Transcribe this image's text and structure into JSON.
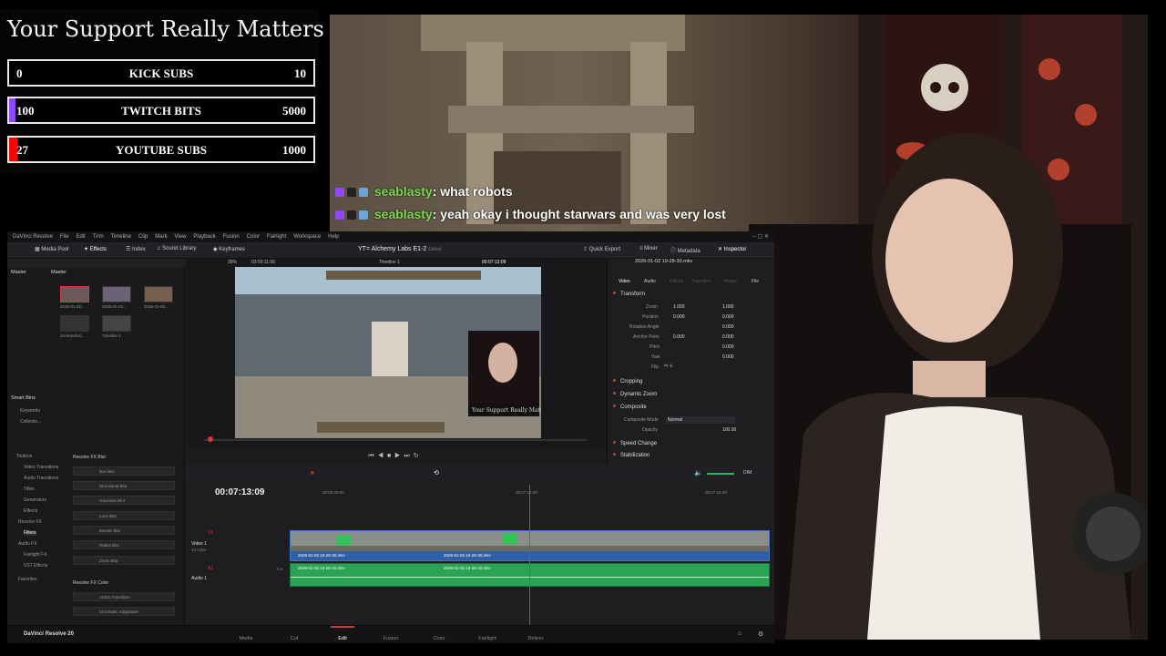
{
  "overlay": {
    "title": "Your Support Really Matters",
    "goals": [
      {
        "label": "KICK SUBS",
        "current": "0",
        "target": "10",
        "progress": 0.0,
        "color": "#53fc18"
      },
      {
        "label": "TWITCH BITS",
        "current": "100",
        "target": "5000",
        "progress": 0.02,
        "color": "#9146ff"
      },
      {
        "label": "YOUTUBE SUBS",
        "current": "27",
        "target": "1000",
        "progress": 0.027,
        "color": "#ff0000"
      }
    ]
  },
  "chat": [
    {
      "user": "seablasty",
      "message": ": what robots"
    },
    {
      "user": "seablasty",
      "message": ": yeah okay i thought starwars and was very lost"
    }
  ],
  "resolve": {
    "menu": [
      "DaVinci Resolve",
      "File",
      "Edit",
      "Trim",
      "Timeline",
      "Clip",
      "Mark",
      "View",
      "Playback",
      "Fusion",
      "Color",
      "Fairlight",
      "Workspace",
      "Help"
    ],
    "toolbar": {
      "media_pool": "Media Pool",
      "effects": "Effects",
      "index": "Index",
      "sound_library": "Sound Library",
      "keyframes": "Keyframes",
      "project_title": "YT= Alchemy Labs E1-2",
      "edited": "Edited",
      "quick_export": "Quick Export",
      "mixer": "Mixer",
      "metadata": "Metadata",
      "inspector": "Inspector"
    },
    "bins": {
      "master": "Master",
      "master_sub": "Master",
      "smart_bins": "Smart Bins",
      "keywords": "Keywords",
      "collections": "Collectio..."
    },
    "clips": [
      {
        "name": "2026-01-02..."
      },
      {
        "name": "2026-01-02..."
      },
      {
        "name": "2026-01-02..."
      },
      {
        "name": "Screenshot..."
      },
      {
        "name": "Timeline 1"
      }
    ],
    "viewer": {
      "zoom": "39%",
      "duration": "03:59:11:06",
      "timeline_name": "Timeline 1",
      "timecode": "00:07:13:09",
      "clip_name": "2026-01-02 19-28-30.mkv"
    },
    "inspector": {
      "tabs": [
        "Video",
        "Audio",
        "Effects",
        "Transition",
        "Image",
        "File"
      ],
      "transform": "Transform",
      "zoom_label": "Zoom",
      "zoom_x": "1.000",
      "zoom_y": "1.000",
      "position_label": "Position",
      "position_x": "0.000",
      "position_y": "0.000",
      "rotation_label": "Rotation Angle",
      "rotation_value": "0.000",
      "anchor_label": "Anchor Point",
      "anchor_x": "0.000",
      "anchor_y": "0.000",
      "pitch_label": "Pitch",
      "pitch_value": "0.000",
      "yaw_label": "Yaw",
      "yaw_value": "0.000",
      "flip_label": "Flip",
      "cropping": "Cropping",
      "dynamic_zoom": "Dynamic Zoom",
      "composite": "Composite",
      "composite_mode_label": "Composite Mode",
      "composite_mode_value": "Normal",
      "opacity_label": "Opacity",
      "opacity_value": "100.00",
      "speed_change": "Speed Change",
      "stabilization": "Stabilization"
    },
    "effects": {
      "tree": [
        "Toolbox",
        "Video Transitions",
        "Audio Transitions",
        "Titles",
        "Generators",
        "Effects",
        "Resolve FX",
        "Filters",
        "Audio FX",
        "Fairlight FX",
        "VST Effects",
        "Favorites"
      ],
      "group1": "Resolve FX Blur",
      "group1_items": [
        "Box Blur",
        "Directional Blur",
        "Gaussian Blur",
        "Lens Blur",
        "Mosaic Blur",
        "Radial Blur",
        "Zoom Blur"
      ],
      "group2": "Resolve FX Color",
      "group2_items": [
        "ACES Transform",
        "Chromatic Adaptation"
      ]
    },
    "timeline": {
      "timecode": "00:07:13:09",
      "ruler": [
        "00:00:00:00",
        "00:07:12:00",
        "00:07:24:00"
      ],
      "v1": "V1",
      "video_track": "Video 1",
      "clip_count": "13 Clips",
      "a1": "A1",
      "audio_track": "Audio 1",
      "audio_level": "2.0",
      "clip_a": "2026-01-02 19-28-30.mkv",
      "clip_b": "2026-01-02 19-28-30.mkv",
      "aclip_a": "2026-01-02 19-28-30.mkv",
      "aclip_b": "2026-01-02 19-28-30.mkv",
      "dim": "DIM"
    },
    "pages": [
      "Media",
      "Cut",
      "Edit",
      "Fusion",
      "Color",
      "Fairlight",
      "Deliver"
    ],
    "active_page": "Edit",
    "app_name": "DaVinci Resolve 20"
  }
}
